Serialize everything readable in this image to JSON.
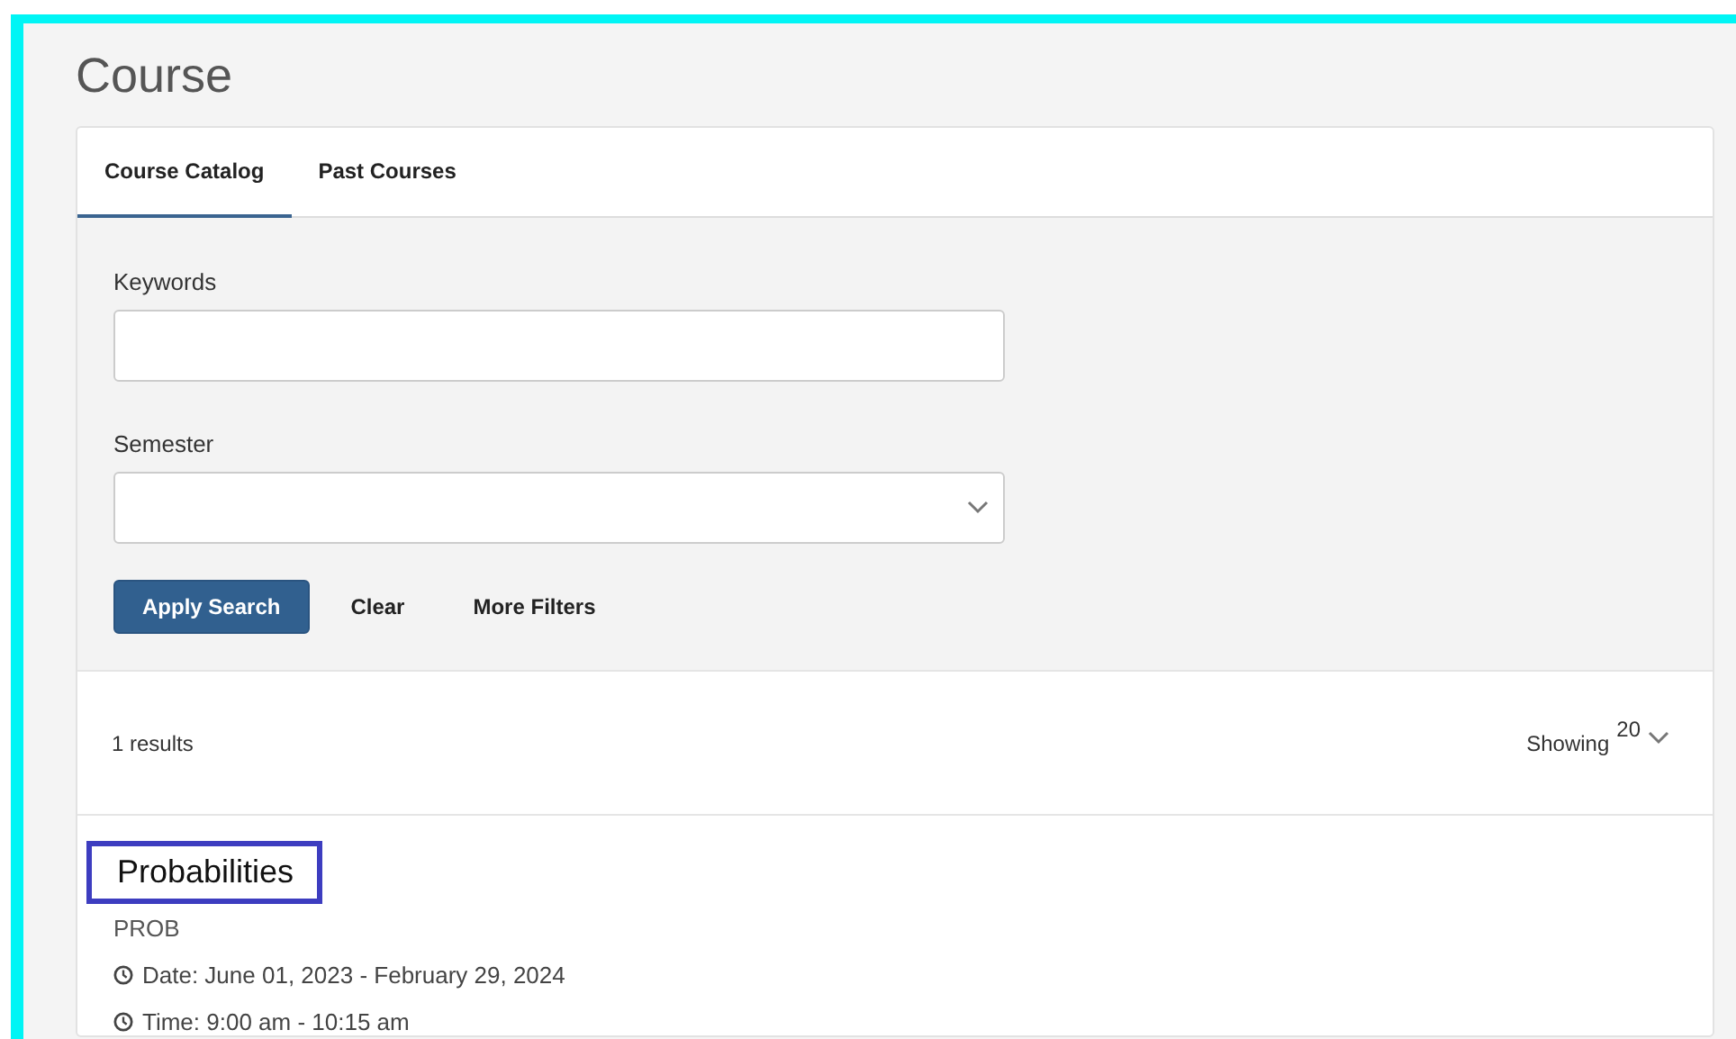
{
  "page_title": "Course",
  "tabs": [
    {
      "label": "Course Catalog",
      "selected": true
    },
    {
      "label": "Past Courses",
      "selected": false
    }
  ],
  "search": {
    "keywords": {
      "label": "Keywords"
    },
    "semester": {
      "label": "Semester"
    },
    "buttons": [
      {
        "label": "Apply Search",
        "kind": "primary"
      },
      {
        "label": "Clear",
        "kind": "plain"
      },
      {
        "label": "More Filters",
        "kind": "plain"
      }
    ]
  },
  "results": {
    "count": "1 results",
    "showing_label": "Showing",
    "page_size": "20"
  },
  "courses": [
    {
      "title": "Probabilities",
      "highlighted": true,
      "code": "PROB",
      "details": [
        "Date: June 01, 2023 - February 29, 2024",
        "Time: 9:00 am - 10:15 am"
      ]
    }
  ]
}
